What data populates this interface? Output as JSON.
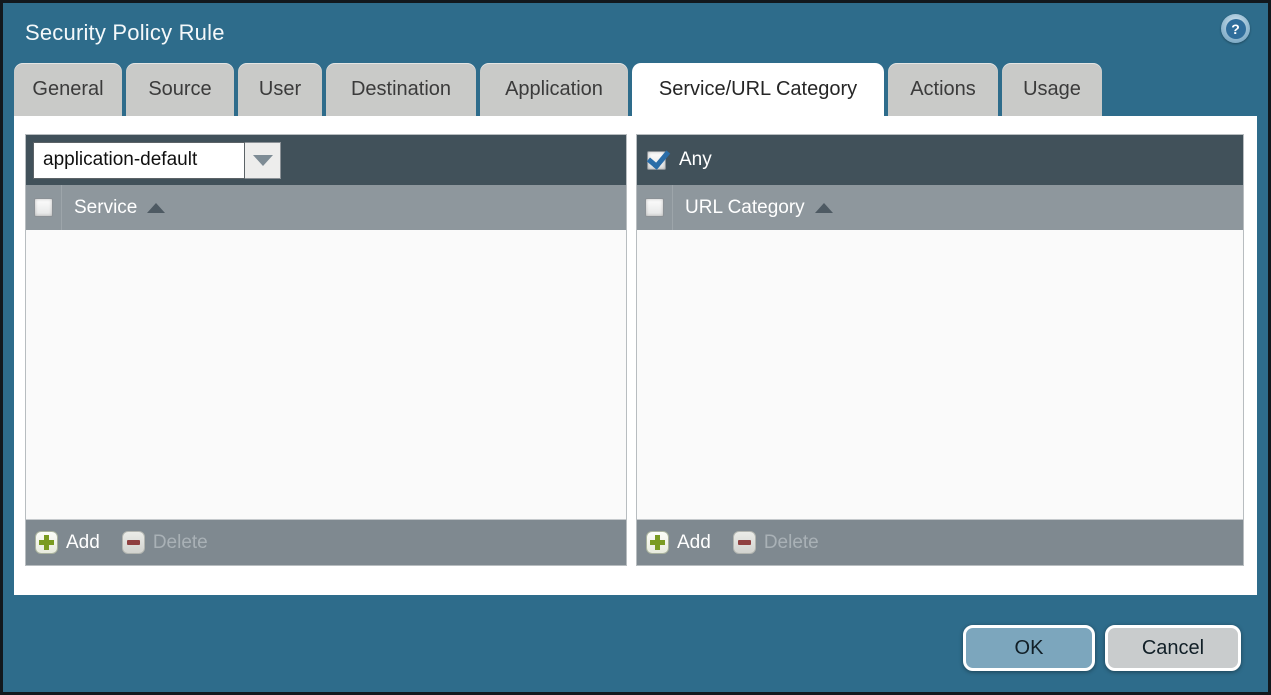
{
  "window": {
    "title": "Security Policy Rule"
  },
  "icons": {
    "help": "?"
  },
  "tabs": [
    {
      "label": "General",
      "active": false
    },
    {
      "label": "Source",
      "active": false
    },
    {
      "label": "User",
      "active": false
    },
    {
      "label": "Destination",
      "active": false
    },
    {
      "label": "Application",
      "active": false
    },
    {
      "label": "Service/URL Category",
      "active": true
    },
    {
      "label": "Actions",
      "active": false
    },
    {
      "label": "Usage",
      "active": false
    }
  ],
  "service_panel": {
    "dropdown_value": "application-default",
    "column_header": "Service",
    "header_checkbox_checked": false,
    "rows": [],
    "add_label": "Add",
    "delete_label": "Delete",
    "delete_disabled": true
  },
  "url_category_panel": {
    "any_label": "Any",
    "any_checkbox_checked": true,
    "column_header": "URL Category",
    "header_checkbox_checked": false,
    "rows": [],
    "add_label": "Add",
    "delete_label": "Delete",
    "delete_disabled": true
  },
  "buttons": {
    "ok": "OK",
    "cancel": "Cancel"
  },
  "colors": {
    "dialog_bg": "#2e6c8b",
    "tab_bg": "#c9cac8",
    "tab_active_bg": "#ffffff",
    "panel_topbar_bg": "#41515a",
    "panel_header_bg": "#8e979d",
    "panel_footer_bg": "#7f8990",
    "list_bg": "#fafafa",
    "ok_button_bg": "#7ca6bd",
    "cancel_button_bg": "#c9cccd",
    "add_plus_green": "#7a9b21",
    "delete_minus_red": "#8f4040",
    "checkmark_blue": "#2a6da8"
  }
}
